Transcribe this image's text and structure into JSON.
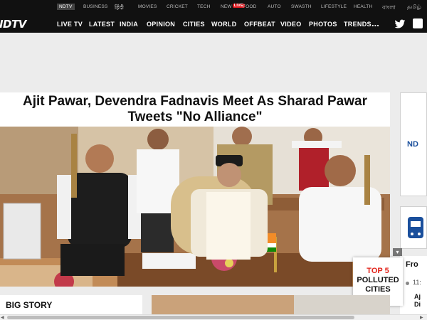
{
  "topbar": {
    "links": [
      "NDTV",
      "BUSINESS",
      "हिंदी",
      "MOVIES",
      "CRICKET",
      "TECH",
      "NEW",
      "FOOD",
      "AUTO",
      "SWASTH",
      "LIFESTYLE",
      "HEALTH",
      "বাংলা",
      "தமிழ்"
    ],
    "live_badge": "LIVE"
  },
  "nav": {
    "logo": "NDTV",
    "items": [
      "LIVE TV",
      "LATEST",
      "INDIA",
      "OPINION",
      "CITIES",
      "WORLD",
      "OFFBEAT",
      "VIDEO",
      "PHOTOS",
      "TRENDS"
    ],
    "more": "..."
  },
  "headline": "Ajit Pawar, Devendra Fadnavis Meet As Sharad Pawar Tweets \"No Alliance\"",
  "sidebar": {
    "card1_text": "ND",
    "card3_title": "Fro",
    "card3_num": "11:",
    "card3_snippet": "Aj Di"
  },
  "top5": {
    "line1": "TOP 5",
    "line2": "POLLUTED",
    "line3": "CITIES"
  },
  "bigstory": "BIG STORY",
  "colors": {
    "nav_bg": "#111111",
    "accent_red": "#e2231a",
    "ndtv_blue": "#1a4f9c"
  }
}
